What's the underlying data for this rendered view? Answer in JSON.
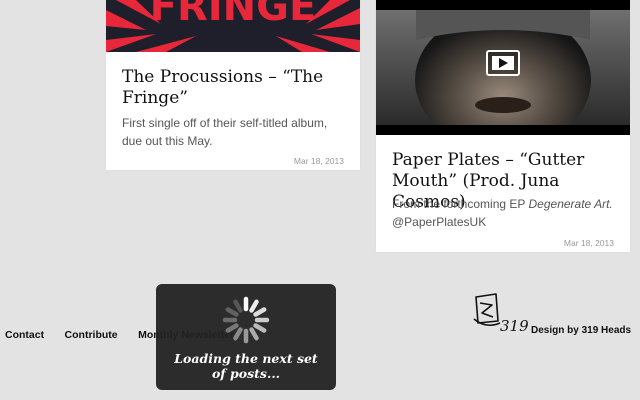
{
  "posts": [
    {
      "thumb_text": "FRINGE",
      "title": "The Procussions – “The Fringe”",
      "excerpt": "First single off of their self-titled album, due out this May.",
      "date": "Mar 18, 2013"
    },
    {
      "title": "Paper Plates – “Gutter Mouth” (Prod. Juna Cosmos)",
      "excerpt_before": "From the forthcoming EP ",
      "excerpt_emphasis": "Degenerate Art.",
      "excerpt_after": "@PaperPlatesUK",
      "date": "Mar 18, 2013",
      "video_icon": "play-icon"
    }
  ],
  "footer": {
    "nav": [
      "Contact",
      "Contribute",
      "Monthly Newsletter"
    ],
    "logo_text": "319",
    "credit": "Design by 319 Heads"
  },
  "loader": {
    "text": "Loading the next set of posts...",
    "icon": "spinner-icon"
  },
  "colors": {
    "background": "#e3e3e3",
    "card": "#ffffff",
    "fringe_red": "#e8273a",
    "loader_bg": "#222222"
  }
}
